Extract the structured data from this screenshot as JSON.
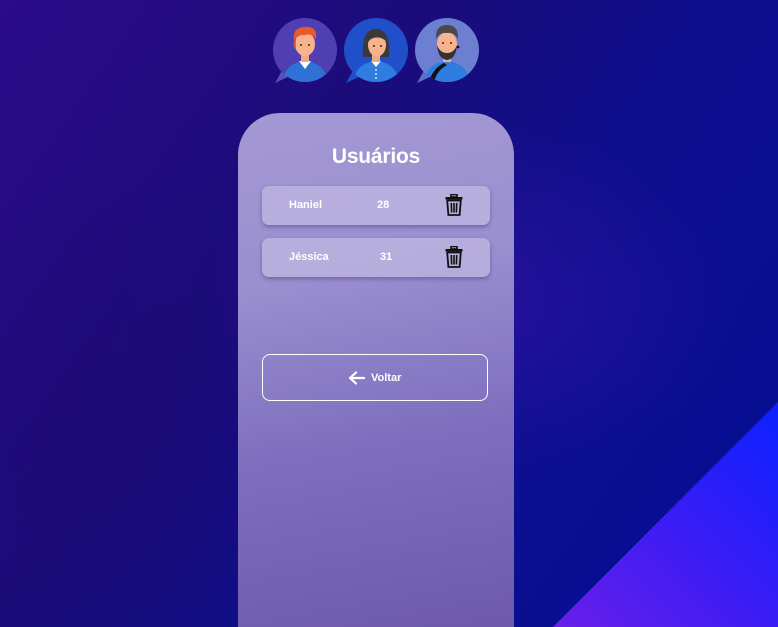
{
  "page": {
    "title": "Usuários"
  },
  "avatars": [
    {
      "name": "avatar-redhead-man"
    },
    {
      "name": "avatar-woman"
    },
    {
      "name": "avatar-bearded-man"
    }
  ],
  "users": [
    {
      "name": "Haniel",
      "age": "28"
    },
    {
      "name": "Jéssica",
      "age": "31"
    }
  ],
  "actions": {
    "back_label": "Voltar"
  },
  "icons": {
    "delete": "trash-icon",
    "back": "arrow-left-icon"
  },
  "colors": {
    "background": "#1b0c7a",
    "card": "#9a8fcf",
    "accent_triangle": "#1a1cff",
    "text": "#ffffff"
  }
}
